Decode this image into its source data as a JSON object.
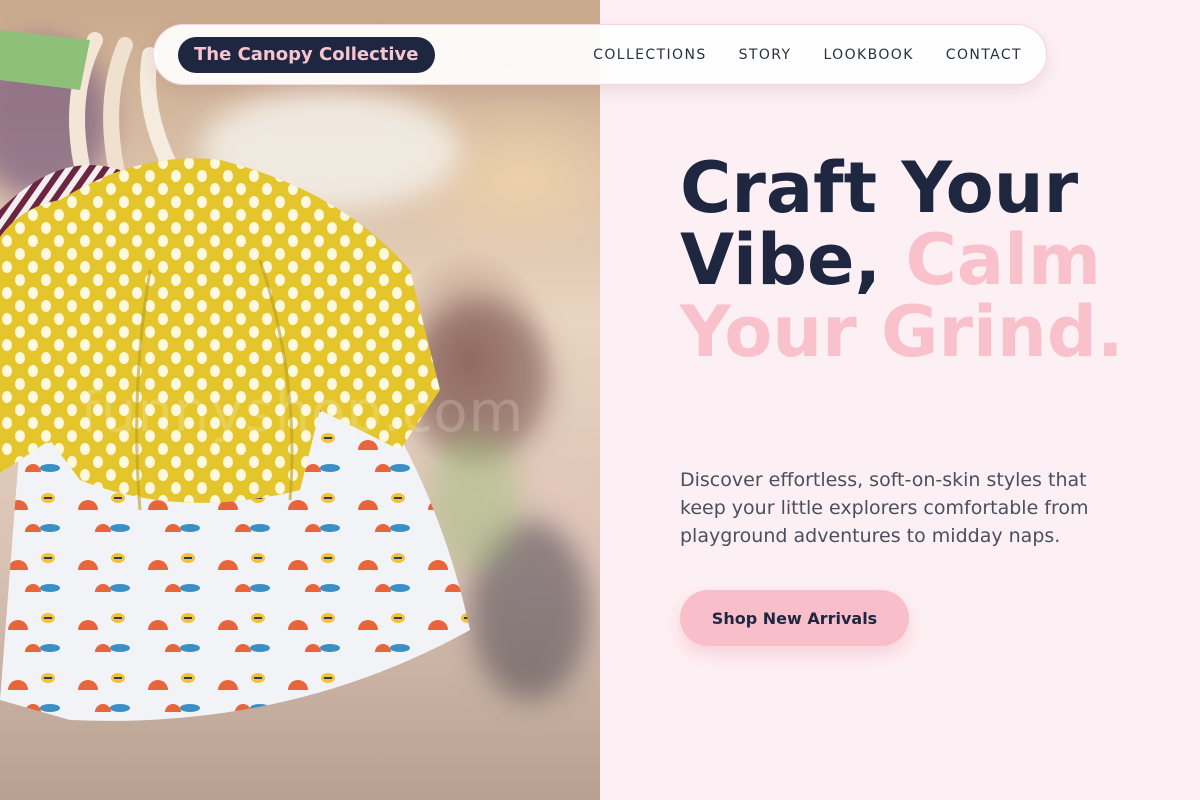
{
  "brand": {
    "name": "The Canopy Collective"
  },
  "nav": {
    "items": [
      {
        "label": "COLLECTIONS"
      },
      {
        "label": "STORY"
      },
      {
        "label": "LOOKBOOK"
      },
      {
        "label": "CONTACT"
      }
    ]
  },
  "hero": {
    "title_part1": "Craft Your Vibe, ",
    "title_accent": "Calm Your Grind.",
    "description": "Discover effortless, soft-on-skin styles that keep your little explorers comfortable from playground adventures to midday naps.",
    "cta_label": "Shop New Arrivals",
    "image_watermark": "funnyshop.com"
  },
  "colors": {
    "navy": "#1e2640",
    "pink_accent": "#f9c1cc",
    "background": "#fdf0f4",
    "button": "#f8bfca"
  }
}
